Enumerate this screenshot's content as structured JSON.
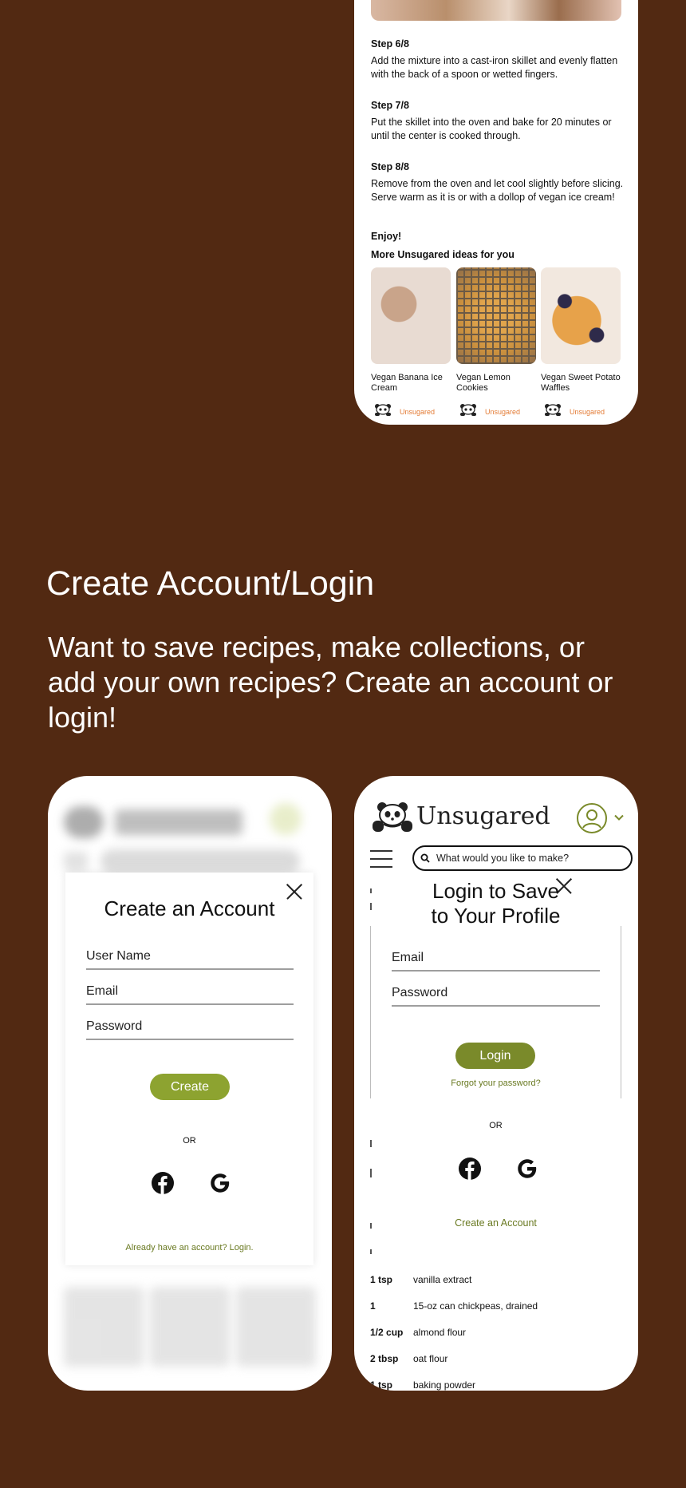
{
  "recipe_screen": {
    "steps": [
      {
        "title": "Step 6/8",
        "text": "Add the mixture into a cast-iron skillet and evenly flatten with the back of a spoon or wetted fingers."
      },
      {
        "title": "Step 7/8",
        "text": "Put the skillet into the oven and bake for 20 minutes or until the center is cooked through."
      },
      {
        "title": "Step 8/8",
        "text": "Remove from the oven and let cool slightly before slicing. Serve warm as it is or with a dollop of vegan ice cream!"
      }
    ],
    "enjoy": "Enjoy!",
    "more_title": "More Unsugared ideas for you",
    "cards": [
      {
        "caption": "Vegan Banana Ice Cream",
        "brand": "Unsugared"
      },
      {
        "caption": "Vegan Lemon Cookies",
        "brand": "Unsugared"
      },
      {
        "caption": "Vegan Sweet Potato Waffles",
        "brand": "Unsugared"
      }
    ]
  },
  "section": {
    "title": "Create Account/Login",
    "description": "Want to save recipes, make collections, or add your own recipes? Create an account or login!"
  },
  "signup_modal": {
    "title": "Create an Account",
    "username_placeholder": "User Name",
    "email_placeholder": "Email",
    "password_placeholder": "Password",
    "create_label": "Create",
    "or_label": "OR",
    "login_link": "Already have an account? Login."
  },
  "login_screen": {
    "logo_text": "Unsugared",
    "search_placeholder": "What would you like to make?",
    "modal_title_line1": "Login to Save",
    "modal_title_line2": "to Your Profile",
    "email_placeholder": "Email",
    "password_placeholder": "Password",
    "login_label": "Login",
    "forgot_link": "Forgot your password?",
    "or_label": "OR",
    "create_link": "Create an Account",
    "ingredients": [
      {
        "qty": "1 tsp",
        "name": "vanilla extract"
      },
      {
        "qty": "1",
        "name": "15-oz can chickpeas, drained"
      },
      {
        "qty": "1/2 cup",
        "name": "almond flour"
      },
      {
        "qty": "2 tbsp",
        "name": "oat flour"
      },
      {
        "qty": "1 tsp",
        "name": "baking powder"
      }
    ]
  },
  "colors": {
    "background": "#522912",
    "accent_green": "#7a8a2a",
    "create_green": "#8da330",
    "brand_orange": "#e37b35"
  },
  "icons": [
    "panda-logo-icon",
    "user-avatar-icon",
    "chevron-down-icon",
    "menu-icon",
    "search-icon",
    "close-icon",
    "facebook-icon",
    "google-icon"
  ]
}
